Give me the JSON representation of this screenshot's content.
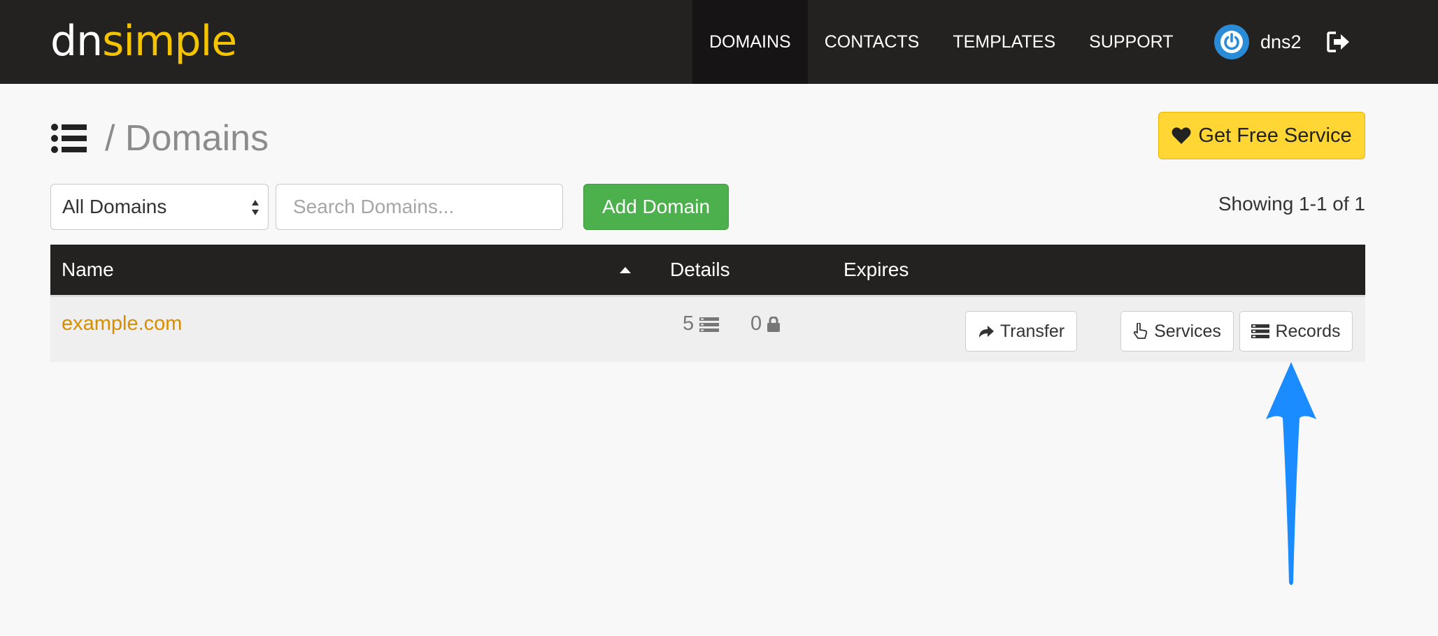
{
  "nav": {
    "logo_dn": "dn",
    "logo_simple": "simple",
    "links": [
      {
        "label": "DOMAINS"
      },
      {
        "label": "CONTACTS"
      },
      {
        "label": "TEMPLATES"
      },
      {
        "label": "SUPPORT"
      }
    ],
    "user": "dns2"
  },
  "page": {
    "title": "/ Domains",
    "free_service_label": "Get Free Service"
  },
  "controls": {
    "filter_value": "All Domains",
    "search_placeholder": "Search Domains...",
    "add_label": "Add Domain",
    "showing": "Showing 1-1 of 1"
  },
  "table": {
    "headers": {
      "name": "Name",
      "details": "Details",
      "expires": "Expires"
    },
    "rows": [
      {
        "name": "example.com",
        "records_count": "5",
        "ssl_count": "0",
        "transfer_label": "Transfer",
        "services_label": "Services",
        "records_label": "Records"
      }
    ]
  },
  "colors": {
    "navbar": "#242121",
    "brand_yellow": "#f5c400",
    "domain_link": "#d98e00",
    "add_green": "#4cb04c",
    "annotation_arrow": "#1a8cff"
  }
}
